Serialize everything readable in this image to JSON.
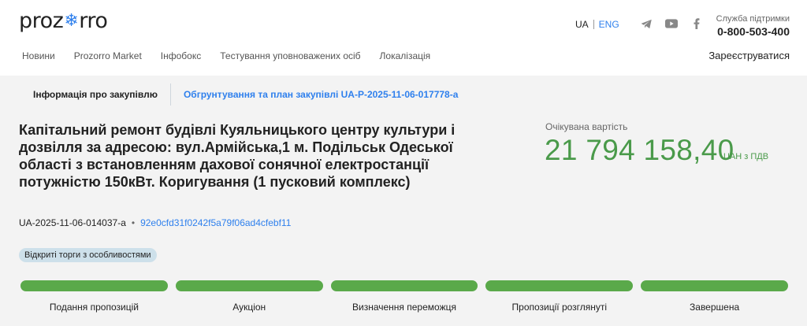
{
  "header": {
    "logo_left": "proz",
    "logo_right": "rro",
    "lang_ua": "UA",
    "lang_eng": "ENG",
    "support_label": "Служба підтримки",
    "support_phone": "0-800-503-400",
    "nav": [
      "Новини",
      "Prozorro Market",
      "Інфобокс",
      "Тестування уповноважених осіб",
      "Локалізація"
    ],
    "register": "Зареєструватися",
    "icons": [
      "telegram-icon",
      "youtube-icon",
      "facebook-icon"
    ]
  },
  "tabs": {
    "info": "Інформація про закупівлю",
    "plan": "Обгрунтування та план закупівлі UA-P-2025-11-06-017778-a"
  },
  "tender": {
    "title": "Капітальний ремонт будівлі Куяльницького центру культури і дозвілля за адресою: вул.Армійська,1 м. Подільськ Одеської області з встановленням дахової сонячної електростанції потужністю 150кВт. Коригування (1 пусковий комплекс)",
    "id": "UA-2025-11-06-014037-a",
    "hash": "92e0cfd31f0242f5a79f06ad4cfebf11",
    "badge": "Відкриті торги з особливостями"
  },
  "price": {
    "label": "Очікувана вартість",
    "value": "21 794 158,40",
    "unit": "UAH з ПДВ"
  },
  "progress": {
    "steps": [
      "Подання пропозицій",
      "Аукціон",
      "Визначення переможця",
      "Пропозиції розглянуті",
      "Завершена"
    ],
    "completed_steps": 5,
    "color": "#5aa94a"
  }
}
